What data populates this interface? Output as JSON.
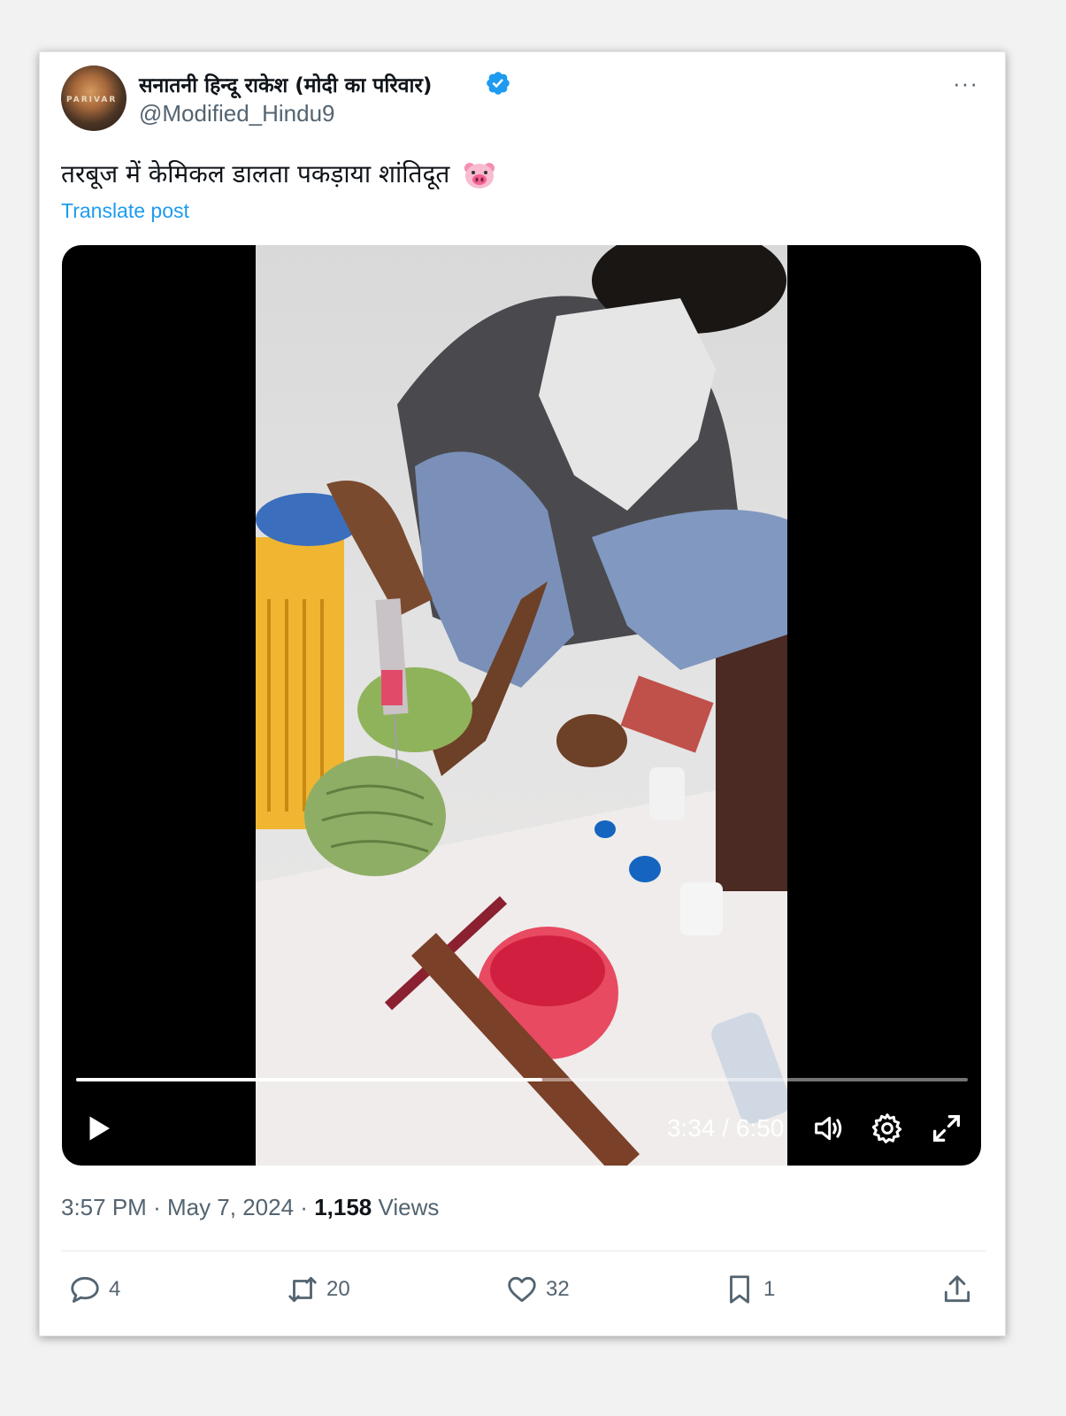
{
  "post": {
    "author_name": "सनातनी हिन्दू राकेश (मोदी का परिवार)",
    "handle": "@Modified_Hindu9",
    "avatar_text": "PARIVAR",
    "more_label": "···",
    "text": "तरबूज में केमिकल डालता पकड़ाया शांतिदूत",
    "emoji_icon": "pig-face-icon",
    "translate_label": "Translate post"
  },
  "video": {
    "progress": 0.523,
    "current_time": "3:34",
    "separator": "/",
    "duration": "6:50",
    "icons": [
      "play-icon",
      "volume-icon",
      "settings-icon",
      "fullscreen-icon"
    ]
  },
  "meta": {
    "time": "3:57 PM",
    "date": "May 7, 2024",
    "views_count": "1,158",
    "views_label": "Views"
  },
  "actions": {
    "replies": "4",
    "reposts": "20",
    "likes": "32",
    "bookmarks": "1"
  },
  "colors": {
    "accent": "#1d9bf0",
    "secondary_text": "#536471"
  }
}
